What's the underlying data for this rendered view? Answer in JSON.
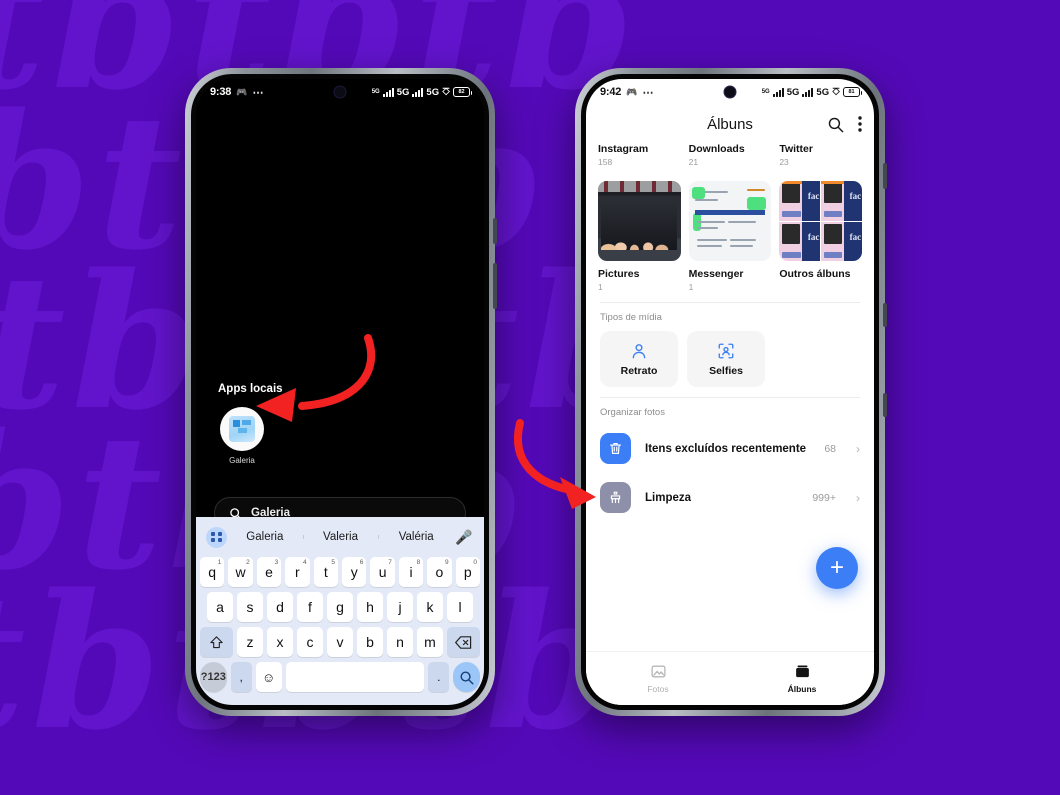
{
  "background": {
    "color": "#5409b8",
    "watermark_text": "tbtbtb",
    "watermark_color": "#6214cc"
  },
  "phone_left": {
    "status_bar": {
      "time": "9:38",
      "dots": "⋯",
      "network_label_1": "5G",
      "network_label_2": "5G",
      "battery_level": "82"
    },
    "home_screen": {
      "section_label": "Apps locais",
      "app": {
        "name": "Galeria",
        "icon": "gallery-icon"
      },
      "search": {
        "value": "Galeria",
        "icon": "search-icon"
      }
    },
    "keyboard": {
      "suggestions": [
        "Galeria",
        "Valeria",
        "Valéria"
      ],
      "grid_icon": "keyboard-grid-icon",
      "mic_icon": "microphone-icon",
      "row1": [
        {
          "k": "q",
          "n": "1"
        },
        {
          "k": "w",
          "n": "2"
        },
        {
          "k": "e",
          "n": "3"
        },
        {
          "k": "r",
          "n": "4"
        },
        {
          "k": "t",
          "n": "5"
        },
        {
          "k": "y",
          "n": "6"
        },
        {
          "k": "u",
          "n": "7"
        },
        {
          "k": "i",
          "n": "8"
        },
        {
          "k": "o",
          "n": "9"
        },
        {
          "k": "p",
          "n": "0"
        }
      ],
      "row2": [
        "a",
        "s",
        "d",
        "f",
        "g",
        "h",
        "j",
        "k",
        "l"
      ],
      "row3": [
        "z",
        "x",
        "c",
        "v",
        "b",
        "n",
        "m"
      ],
      "shift_icon": "shift-icon",
      "backspace_icon": "backspace-icon",
      "num_key": "?123",
      "comma_key": ",",
      "emoji_icon": "emoji-icon",
      "space_key": "",
      "period_key": ".",
      "enter_icon": "search-icon"
    }
  },
  "phone_right": {
    "status_bar": {
      "time": "9:42",
      "dots": "⋯",
      "network_label_1": "5G",
      "network_label_2": "5G",
      "battery_level": "81"
    },
    "header": {
      "title": "Álbuns",
      "search_icon": "search-icon",
      "menu_icon": "overflow-menu-icon"
    },
    "albums": [
      {
        "name": "Instagram",
        "count": "158",
        "thumb": "none"
      },
      {
        "name": "Downloads",
        "count": "21",
        "thumb": "none"
      },
      {
        "name": "Twitter",
        "count": "23",
        "thumb": "none"
      },
      {
        "name": "Pictures",
        "count": "1",
        "thumb": "group-photo"
      },
      {
        "name": "Messenger",
        "count": "1",
        "thumb": "ticket-document"
      },
      {
        "name": "Outros álbuns",
        "count": "",
        "thumb": "collage"
      }
    ],
    "media_types": {
      "label": "Tipos de mídia",
      "items": [
        {
          "label": "Retrato",
          "icon": "portrait-person-icon"
        },
        {
          "label": "Selfies",
          "icon": "selfie-face-frame-icon"
        }
      ]
    },
    "organize": {
      "label": "Organizar fotos",
      "items": [
        {
          "label": "Itens excluídos recentemente",
          "count": "68",
          "icon": "trash-icon",
          "icon_color": "#3b7ef5"
        },
        {
          "label": "Limpeza",
          "count": "999+",
          "icon": "broom-icon",
          "icon_color": "#8e8fa8"
        }
      ]
    },
    "fab": {
      "icon": "plus-icon",
      "color": "#3b7ef5"
    },
    "bottom_nav": [
      {
        "label": "Fotos",
        "icon": "photos-icon",
        "active": false
      },
      {
        "label": "Álbuns",
        "icon": "albums-icon",
        "active": true
      }
    ]
  },
  "annotations": {
    "arrow_1": {
      "name": "red-arrow-to-gallery-app",
      "color": "#f22222"
    },
    "arrow_2": {
      "name": "red-arrow-to-recently-deleted",
      "color": "#f22222"
    }
  }
}
